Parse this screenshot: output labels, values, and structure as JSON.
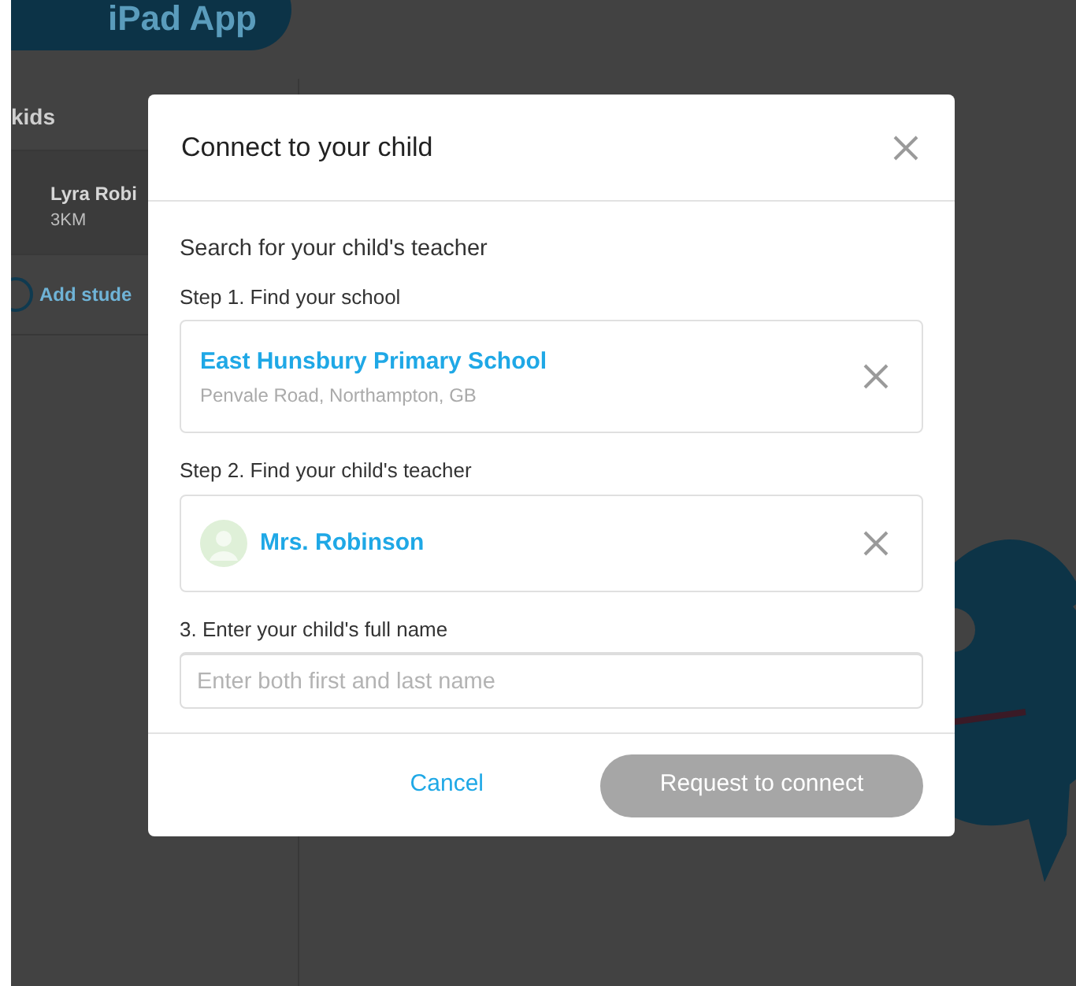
{
  "background": {
    "app_button": "iPad App",
    "sidebar_heading": "kids",
    "students": [
      {
        "name": "Lyra Robi",
        "subtitle": "3KM"
      }
    ],
    "add_student": "Add stude"
  },
  "dialog": {
    "title": "Connect to your child",
    "intro": "Search for your child's teacher",
    "steps": [
      {
        "kind": "school",
        "label": "Step 1. Find your school",
        "title": "East Hunsbury Primary School",
        "subtitle": "Penvale Road, Northampton, GB"
      },
      {
        "kind": "teacher",
        "label": "Step 2. Find your child's teacher",
        "title": "Mrs. Robinson"
      },
      {
        "kind": "input",
        "label": "3. Enter your child's full name",
        "placeholder": "Enter both first and last name"
      }
    ],
    "cancel": "Cancel",
    "submit": {
      "label": "Request to connect",
      "disabled": true
    }
  }
}
